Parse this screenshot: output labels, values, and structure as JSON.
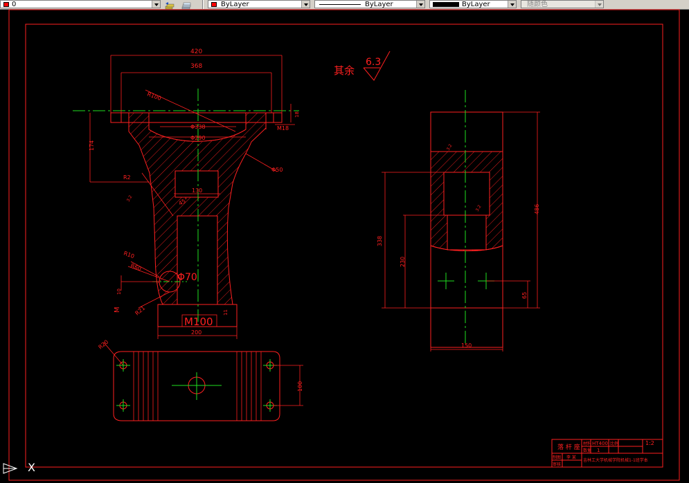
{
  "toolbar": {
    "layer_value": "0",
    "color_value": "ByLayer",
    "linetype_value": "ByLayer",
    "lineweight_value": "ByLayer",
    "plotstyle_value": "随颜色",
    "layer_color": "#ff0000",
    "color_swatch": "#ff0000",
    "lineweight_swatch": "#000000"
  },
  "drawing": {
    "roughness_prefix": "其余",
    "roughness_value": "6.3",
    "dims": {
      "d420": "420",
      "d368": "368",
      "r100": "R100",
      "phi338": "Φ338",
      "phi290": "Φ290",
      "m18": "M18",
      "d18": "18",
      "d174": "174",
      "r2": "R2",
      "phi50": "Φ50",
      "d130": "130",
      "a45": "45°",
      "r10": "R10",
      "r60": "R60",
      "d10": "10",
      "phi70": "Φ70",
      "r21": "R21",
      "m100": "M100",
      "d11": "11",
      "d200": "200",
      "m_side": "M",
      "r20": "R20",
      "d100": "100",
      "d338": "338",
      "d230": "230",
      "d486": "486",
      "d65": "65",
      "d150": "150",
      "s6a": "3.2",
      "s6b": "3.2",
      "s6c": "3.2"
    },
    "title_block": {
      "part_name": "落 杆 座",
      "material_label": "材料",
      "material": "HT400",
      "scale_label": "比例",
      "scale": "1:2",
      "qty_label": "数量",
      "qty": "1",
      "drawn_label": "制图",
      "checked_label": "审核",
      "school": "吉林工大学机械学院机械1-1班学本",
      "drawer": "李 某"
    }
  },
  "ucs": {
    "axis_label": "X"
  }
}
